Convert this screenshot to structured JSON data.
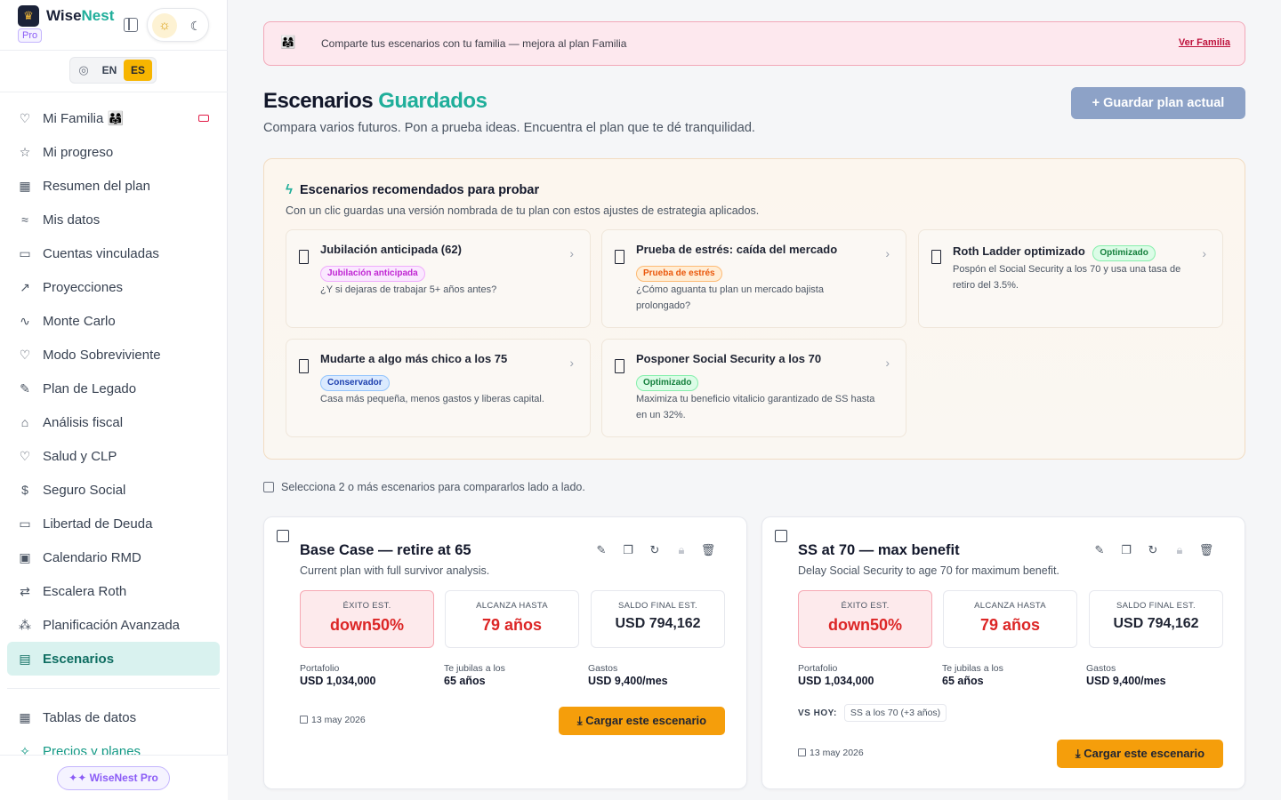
{
  "brand": {
    "name_part1": "Wise",
    "name_part2": "Nest",
    "badge": "Pro"
  },
  "lang": {
    "en": "EN",
    "es": "ES"
  },
  "nav": [
    {
      "label": "Mi Familia 👨‍👩‍👧",
      "icon": "heart-icon"
    },
    {
      "label": "Mi progreso",
      "icon": "star-icon"
    },
    {
      "label": "Resumen del plan",
      "icon": "dashboard-icon"
    },
    {
      "label": "Mis datos",
      "icon": "sliders-icon"
    },
    {
      "label": "Cuentas vinculadas",
      "icon": "wallet-icon"
    },
    {
      "label": "Proyecciones",
      "icon": "trend-icon"
    },
    {
      "label": "Monte Carlo",
      "icon": "pulse-icon"
    },
    {
      "label": "Modo Sobreviviente",
      "icon": "heart-icon"
    },
    {
      "label": "Plan de Legado",
      "icon": "feather-icon"
    },
    {
      "label": "Análisis fiscal",
      "icon": "bank-icon"
    },
    {
      "label": "Salud y CLP",
      "icon": "heart-pulse-icon"
    },
    {
      "label": "Seguro Social",
      "icon": "dollar-circle-icon"
    },
    {
      "label": "Libertad de Deuda",
      "icon": "card-icon"
    },
    {
      "label": "Calendario RMD",
      "icon": "calendar-icon"
    },
    {
      "label": "Escalera Roth",
      "icon": "arrows-icon"
    },
    {
      "label": "Planificación Avanzada",
      "icon": "network-icon"
    },
    {
      "label": "Escenarios",
      "icon": "save-icon"
    }
  ],
  "nav2": [
    {
      "label": "Tablas de datos",
      "icon": "table-icon"
    },
    {
      "label": "Precios y planes",
      "icon": "sparkle-icon"
    }
  ],
  "footer": {
    "pro_label": "✦✦ WiseNest Pro"
  },
  "banner": {
    "emoji": "👨‍👩‍👧",
    "text": "Comparte tus escenarios con tu familia — mejora al plan Familia",
    "link": "Ver Familia"
  },
  "header": {
    "title_part1": "Escenarios ",
    "title_part2": "Guardados",
    "subtitle": "Compara varios futuros. Pon a prueba ideas. Encuentra el plan que te dé tranquilidad.",
    "save_button": "+ Guardar plan actual"
  },
  "recommended": {
    "title": "Escenarios recomendados para probar",
    "subtitle": "Con un clic guardas una versión nombrada de tu plan con estos ajustes de estrategia aplicados.",
    "cards": [
      {
        "title": "Jubilación anticipada (62)",
        "tag": "Jubilación anticipada",
        "desc": "¿Y si dejaras de trabajar 5+ años antes?"
      },
      {
        "title": "Prueba de estrés: caída del mercado",
        "tag": "Prueba de estrés",
        "desc": "¿Cómo aguanta tu plan un mercado bajista prolongado?"
      },
      {
        "title": "Roth Ladder optimizado",
        "tag": "Optimizado",
        "desc": "Pospón el Social Security a los 70 y usa una tasa de retiro del 3.5%."
      },
      {
        "title": "Mudarte a algo más chico a los 75",
        "tag": "Conservador",
        "desc": "Casa más pequeña, menos gastos y liberas capital."
      },
      {
        "title": "Posponer Social Security a los 70",
        "tag": "Optimizado",
        "desc": "Maximiza tu beneficio vitalicio garantizado de SS hasta en un 32%."
      }
    ]
  },
  "select_hint": "Selecciona 2 o más escenarios para compararlos lado a lado.",
  "scenarios": [
    {
      "title": "Base Case — retire at 65",
      "desc": "Current plan with full survivor analysis.",
      "stat1_label": "ÉXITO EST.",
      "stat1_value": "down50%",
      "stat2_label": "ALCANZA HASTA",
      "stat2_value": "79 años",
      "stat3_label": "SALDO FINAL EST.",
      "stat3_value": "USD 794,162",
      "portfolio_label": "Portafolio",
      "portfolio_value": "USD 1,034,000",
      "retire_label": "Te jubilas a los",
      "retire_value": "65 años",
      "spend_label": "Gastos",
      "spend_value": "USD 9,400/mes",
      "date": "13 may 2026",
      "load": "Cargar este escenario"
    },
    {
      "title": "SS at 70 — max benefit",
      "desc": "Delay Social Security to age 70 for maximum benefit.",
      "stat1_label": "ÉXITO EST.",
      "stat1_value": "down50%",
      "stat2_label": "ALCANZA HASTA",
      "stat2_value": "79 años",
      "stat3_label": "SALDO FINAL EST.",
      "stat3_value": "USD 794,162",
      "portfolio_label": "Portafolio",
      "portfolio_value": "USD 1,034,000",
      "retire_label": "Te jubilas a los",
      "retire_value": "65 años",
      "spend_label": "Gastos",
      "spend_value": "USD 9,400/mes",
      "vs_label": "VS HOY:",
      "vs_chip": "SS a los 70 (+3 años)",
      "date": "13 may 2026",
      "load": "Cargar este escenario"
    }
  ]
}
